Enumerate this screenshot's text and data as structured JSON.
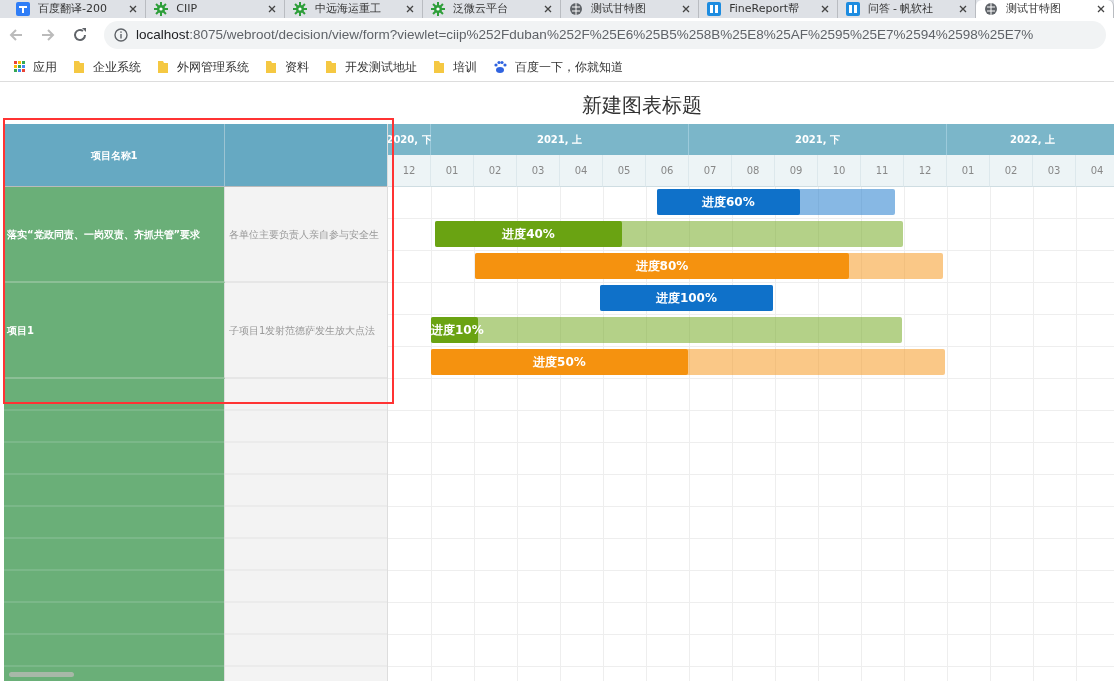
{
  "browser": {
    "tabs": [
      {
        "title": "百度翻译-200",
        "kind": "translate",
        "selected": false
      },
      {
        "title": "CIIP",
        "kind": "gear",
        "selected": false
      },
      {
        "title": "中远海运重工",
        "kind": "gear",
        "selected": false
      },
      {
        "title": "泛微云平台",
        "kind": "gear",
        "selected": false
      },
      {
        "title": "测试甘特图",
        "kind": "globe",
        "selected": false
      },
      {
        "title": "FineReport帮",
        "kind": "report",
        "selected": false
      },
      {
        "title": "问答 - 帆软社",
        "kind": "report",
        "selected": false
      },
      {
        "title": "测试甘特图",
        "kind": "globe",
        "selected": true
      }
    ],
    "address": {
      "host": "localhost",
      "path": ":8075/webroot/decision/view/form?viewlet=ciip%252Fduban%252F%25E6%25B5%258B%25E8%25AF%2595%25E7%2594%2598%25E7%"
    },
    "bookmarks": [
      {
        "label": "应用",
        "kind": "apps"
      },
      {
        "label": "企业系统",
        "kind": "folder"
      },
      {
        "label": "外网管理系统",
        "kind": "folder"
      },
      {
        "label": "资料",
        "kind": "folder"
      },
      {
        "label": "开发测试地址",
        "kind": "folder"
      },
      {
        "label": "培训",
        "kind": "folder"
      },
      {
        "label": "百度一下，你就知道",
        "kind": "paw"
      }
    ]
  },
  "chart": {
    "title": "新建图表标题",
    "column_1": "项目名称1",
    "groups": [
      {
        "name": "落实“党政同责、一岗双责、齐抓共管”要求",
        "detail": "各单位主要负责人亲自参与安全生"
      },
      {
        "name": "项目1",
        "detail": "子项目1发射范德萨发生放大点法"
      }
    ],
    "periods": [
      {
        "label": "2020, 下",
        "months": [
          "12"
        ]
      },
      {
        "label": "2021, 上",
        "months": [
          "01",
          "02",
          "03",
          "04",
          "05",
          "06"
        ]
      },
      {
        "label": "2021, 下",
        "months": [
          "07",
          "08",
          "09",
          "10",
          "11",
          "12"
        ]
      },
      {
        "label": "2022, 上",
        "months": [
          "01",
          "02",
          "03",
          "04"
        ]
      }
    ],
    "bars": [
      {
        "label": "进度60%",
        "color": "#0f71c9",
        "level": 0.6
      },
      {
        "label": "进度40%",
        "color": "#6aa312",
        "level": 0.4
      },
      {
        "label": "进度80%",
        "color": "#f5920f",
        "level": 0.8
      },
      {
        "label": "进度100%",
        "color": "#0f71c9",
        "level": 1
      },
      {
        "label": "进度10%",
        "color": "#6aa312",
        "level": 0.1
      },
      {
        "label": "进度50%",
        "color": "#f5920f",
        "level": 0.5
      }
    ]
  },
  "annotation": {
    "frame": true
  }
}
